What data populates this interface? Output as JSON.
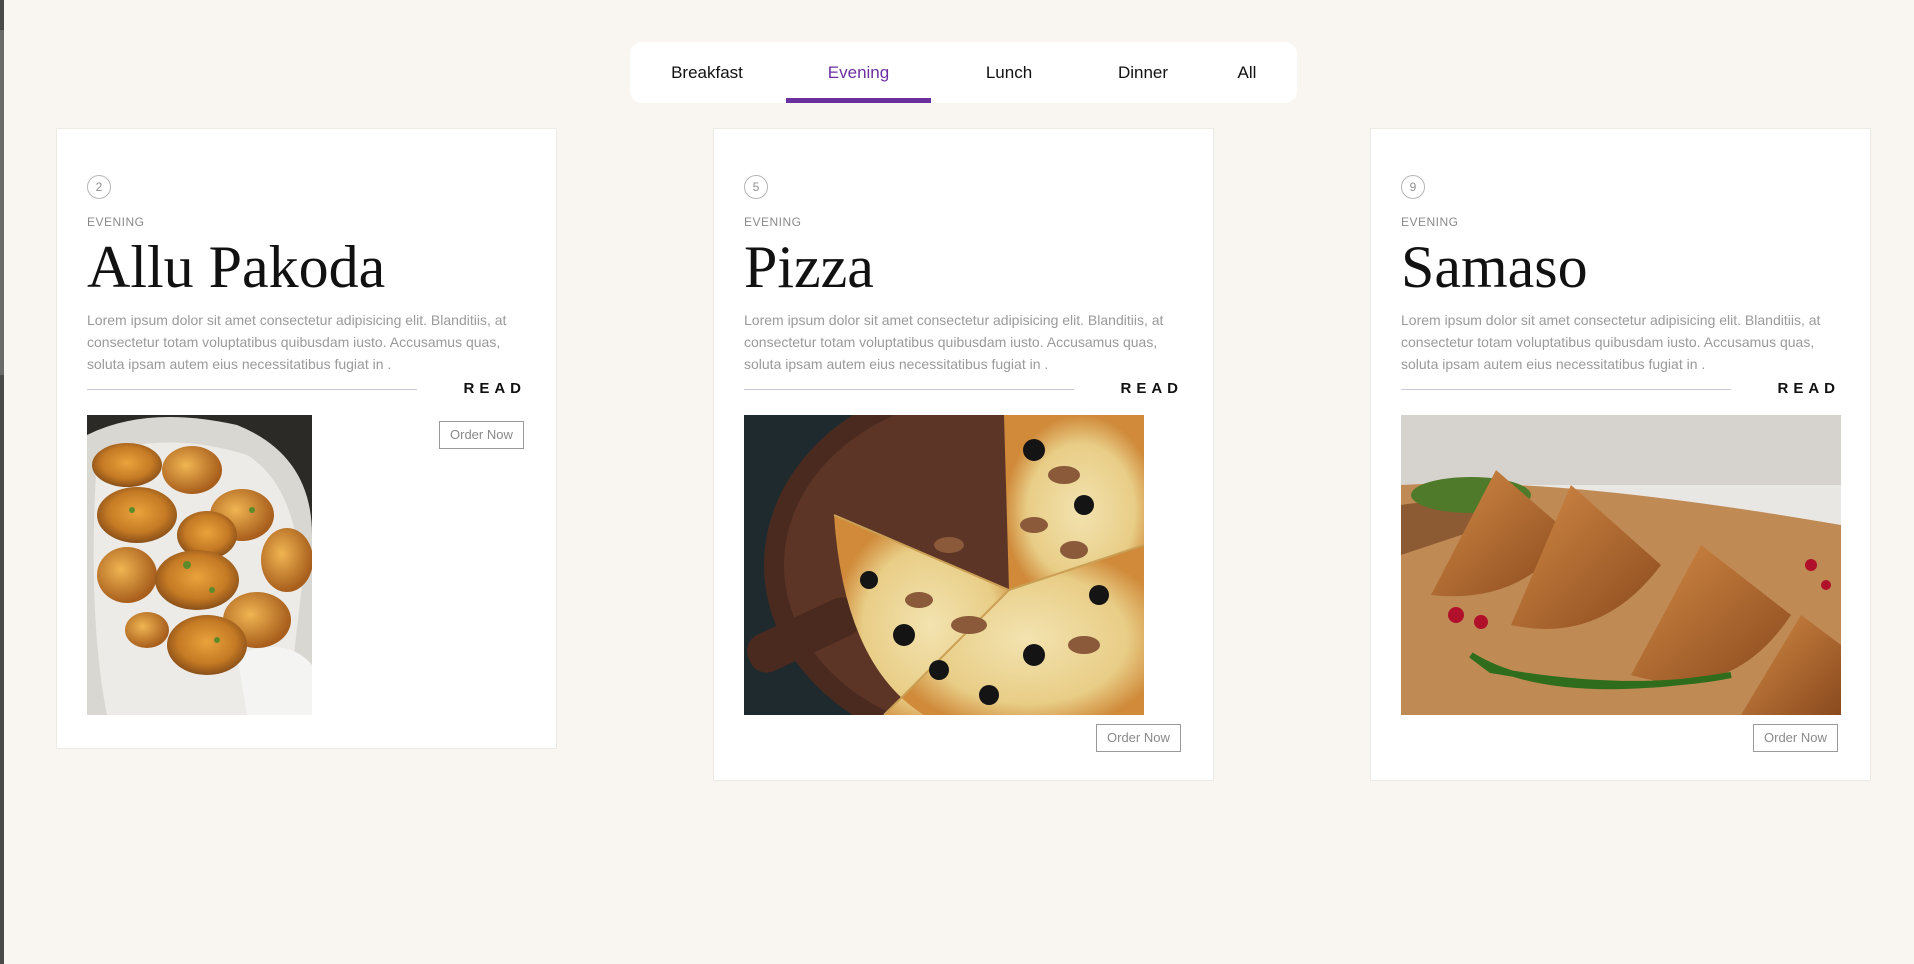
{
  "tabs": [
    {
      "label": "Breakfast"
    },
    {
      "label": "Evening",
      "active": true
    },
    {
      "label": "Lunch"
    },
    {
      "label": "Dinner"
    },
    {
      "label": "All"
    }
  ],
  "colors": {
    "accent": "#6b2fa0",
    "page_background": "#f9f6f2"
  },
  "cards": [
    {
      "number": "2",
      "category": "EVENING",
      "title": "Allu Pakoda",
      "description": "Lorem ipsum dolor sit amet consectetur adipisicing elit. Blanditiis, at consectetur totam voluptatibus quibusdam iusto. Accusamus quas, soluta ipsam autem eius necessitatibus fugiat in .",
      "read_label": "READ",
      "order_label": "Order Now",
      "image": "pakoda-photo"
    },
    {
      "number": "5",
      "category": "EVENING",
      "title": "Pizza",
      "description": "Lorem ipsum dolor sit amet consectetur adipisicing elit. Blanditiis, at consectetur totam voluptatibus quibusdam iusto. Accusamus quas, soluta ipsam autem eius necessitatibus fugiat in .",
      "read_label": "READ",
      "order_label": "Order Now",
      "image": "pizza-photo"
    },
    {
      "number": "9",
      "category": "EVENING",
      "title": "Samaso",
      "description": "Lorem ipsum dolor sit amet consectetur adipisicing elit. Blanditiis, at consectetur totam voluptatibus quibusdam iusto. Accusamus quas, soluta ipsam autem eius necessitatibus fugiat in .",
      "read_label": "READ",
      "order_label": "Order Now",
      "image": "samosa-photo"
    }
  ]
}
